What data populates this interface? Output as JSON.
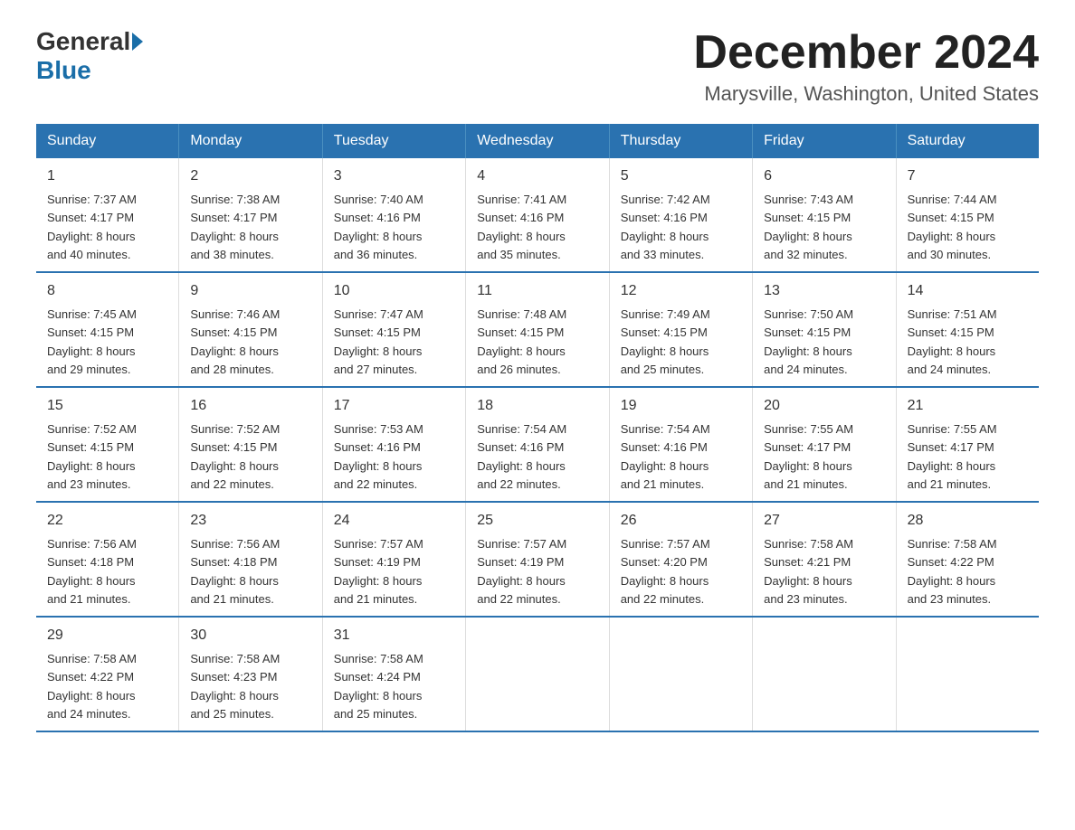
{
  "logo": {
    "general": "General",
    "blue": "Blue"
  },
  "header": {
    "title": "December 2024",
    "subtitle": "Marysville, Washington, United States"
  },
  "days_of_week": [
    "Sunday",
    "Monday",
    "Tuesday",
    "Wednesday",
    "Thursday",
    "Friday",
    "Saturday"
  ],
  "weeks": [
    [
      {
        "day": "1",
        "sunrise": "7:37 AM",
        "sunset": "4:17 PM",
        "daylight": "8 hours and 40 minutes."
      },
      {
        "day": "2",
        "sunrise": "7:38 AM",
        "sunset": "4:17 PM",
        "daylight": "8 hours and 38 minutes."
      },
      {
        "day": "3",
        "sunrise": "7:40 AM",
        "sunset": "4:16 PM",
        "daylight": "8 hours and 36 minutes."
      },
      {
        "day": "4",
        "sunrise": "7:41 AM",
        "sunset": "4:16 PM",
        "daylight": "8 hours and 35 minutes."
      },
      {
        "day": "5",
        "sunrise": "7:42 AM",
        "sunset": "4:16 PM",
        "daylight": "8 hours and 33 minutes."
      },
      {
        "day": "6",
        "sunrise": "7:43 AM",
        "sunset": "4:15 PM",
        "daylight": "8 hours and 32 minutes."
      },
      {
        "day": "7",
        "sunrise": "7:44 AM",
        "sunset": "4:15 PM",
        "daylight": "8 hours and 30 minutes."
      }
    ],
    [
      {
        "day": "8",
        "sunrise": "7:45 AM",
        "sunset": "4:15 PM",
        "daylight": "8 hours and 29 minutes."
      },
      {
        "day": "9",
        "sunrise": "7:46 AM",
        "sunset": "4:15 PM",
        "daylight": "8 hours and 28 minutes."
      },
      {
        "day": "10",
        "sunrise": "7:47 AM",
        "sunset": "4:15 PM",
        "daylight": "8 hours and 27 minutes."
      },
      {
        "day": "11",
        "sunrise": "7:48 AM",
        "sunset": "4:15 PM",
        "daylight": "8 hours and 26 minutes."
      },
      {
        "day": "12",
        "sunrise": "7:49 AM",
        "sunset": "4:15 PM",
        "daylight": "8 hours and 25 minutes."
      },
      {
        "day": "13",
        "sunrise": "7:50 AM",
        "sunset": "4:15 PM",
        "daylight": "8 hours and 24 minutes."
      },
      {
        "day": "14",
        "sunrise": "7:51 AM",
        "sunset": "4:15 PM",
        "daylight": "8 hours and 24 minutes."
      }
    ],
    [
      {
        "day": "15",
        "sunrise": "7:52 AM",
        "sunset": "4:15 PM",
        "daylight": "8 hours and 23 minutes."
      },
      {
        "day": "16",
        "sunrise": "7:52 AM",
        "sunset": "4:15 PM",
        "daylight": "8 hours and 22 minutes."
      },
      {
        "day": "17",
        "sunrise": "7:53 AM",
        "sunset": "4:16 PM",
        "daylight": "8 hours and 22 minutes."
      },
      {
        "day": "18",
        "sunrise": "7:54 AM",
        "sunset": "4:16 PM",
        "daylight": "8 hours and 22 minutes."
      },
      {
        "day": "19",
        "sunrise": "7:54 AM",
        "sunset": "4:16 PM",
        "daylight": "8 hours and 21 minutes."
      },
      {
        "day": "20",
        "sunrise": "7:55 AM",
        "sunset": "4:17 PM",
        "daylight": "8 hours and 21 minutes."
      },
      {
        "day": "21",
        "sunrise": "7:55 AM",
        "sunset": "4:17 PM",
        "daylight": "8 hours and 21 minutes."
      }
    ],
    [
      {
        "day": "22",
        "sunrise": "7:56 AM",
        "sunset": "4:18 PM",
        "daylight": "8 hours and 21 minutes."
      },
      {
        "day": "23",
        "sunrise": "7:56 AM",
        "sunset": "4:18 PM",
        "daylight": "8 hours and 21 minutes."
      },
      {
        "day": "24",
        "sunrise": "7:57 AM",
        "sunset": "4:19 PM",
        "daylight": "8 hours and 21 minutes."
      },
      {
        "day": "25",
        "sunrise": "7:57 AM",
        "sunset": "4:19 PM",
        "daylight": "8 hours and 22 minutes."
      },
      {
        "day": "26",
        "sunrise": "7:57 AM",
        "sunset": "4:20 PM",
        "daylight": "8 hours and 22 minutes."
      },
      {
        "day": "27",
        "sunrise": "7:58 AM",
        "sunset": "4:21 PM",
        "daylight": "8 hours and 23 minutes."
      },
      {
        "day": "28",
        "sunrise": "7:58 AM",
        "sunset": "4:22 PM",
        "daylight": "8 hours and 23 minutes."
      }
    ],
    [
      {
        "day": "29",
        "sunrise": "7:58 AM",
        "sunset": "4:22 PM",
        "daylight": "8 hours and 24 minutes."
      },
      {
        "day": "30",
        "sunrise": "7:58 AM",
        "sunset": "4:23 PM",
        "daylight": "8 hours and 25 minutes."
      },
      {
        "day": "31",
        "sunrise": "7:58 AM",
        "sunset": "4:24 PM",
        "daylight": "8 hours and 25 minutes."
      },
      null,
      null,
      null,
      null
    ]
  ],
  "labels": {
    "sunrise": "Sunrise:",
    "sunset": "Sunset:",
    "daylight": "Daylight:"
  }
}
